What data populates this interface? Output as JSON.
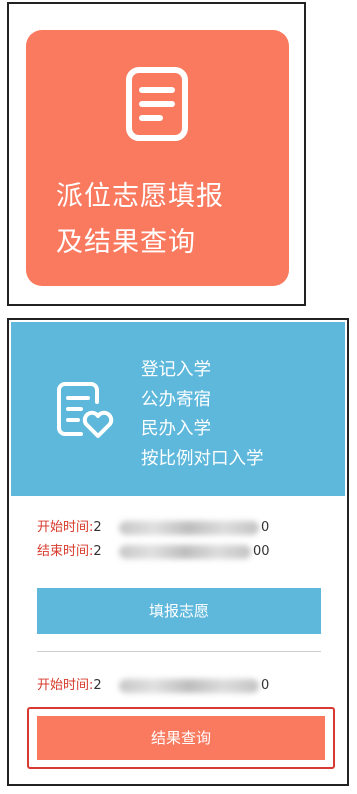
{
  "volunteer_card": {
    "title_line1": "派位志愿填报",
    "title_line2": "及结果查询",
    "icon": "document-icon",
    "color": "#fa7a5f"
  },
  "enrollment_card": {
    "icon": "form-heart-icon",
    "panel_color": "#5db8dc",
    "categories": [
      "登记入学",
      "公办寄宿",
      "民办入学",
      "按比例对口入学"
    ],
    "start_label": "开始时间:",
    "end_label": "结束时间:",
    "start_value_prefix": "2",
    "start_value_suffix": "0",
    "end_value_prefix": "2",
    "end_value_suffix": "00",
    "fill_button": "填报志愿",
    "result_start_label": "开始时间:",
    "result_start_prefix": "2",
    "result_start_suffix": "0",
    "result_button": "结果查询",
    "accent_color": "#fa7a5f",
    "highlight_color": "#d63a32"
  }
}
